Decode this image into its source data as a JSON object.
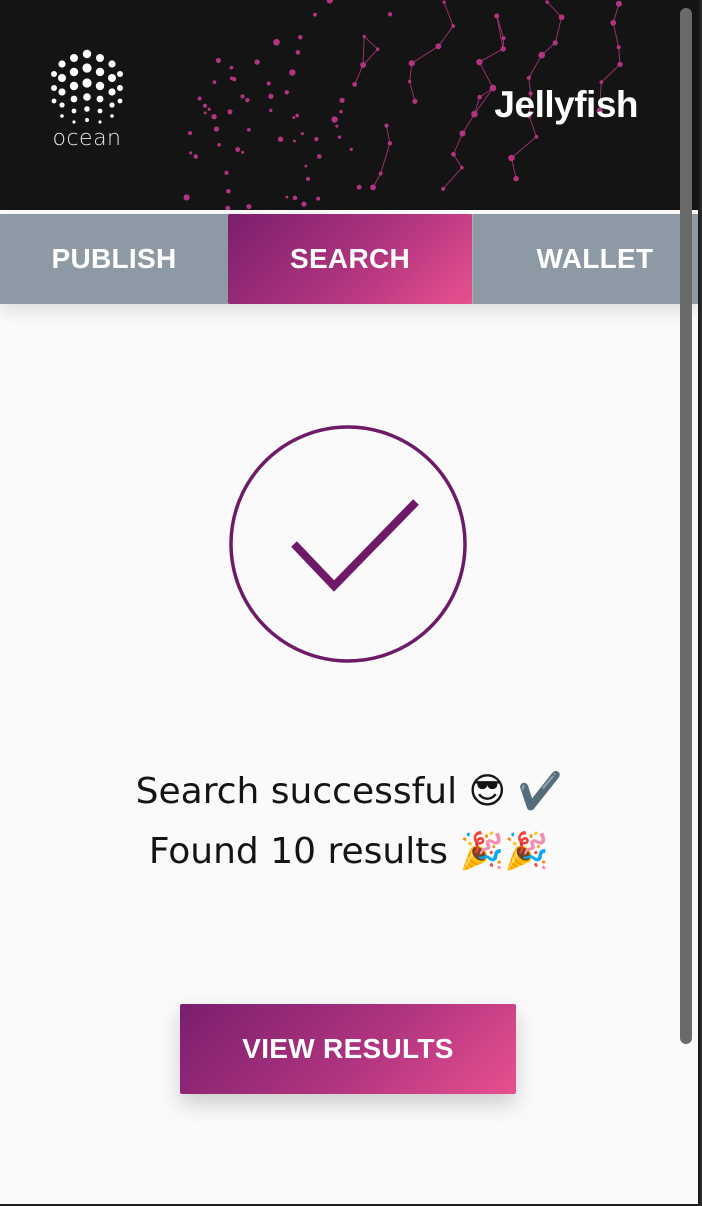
{
  "header": {
    "logo_text": "ocean",
    "brand": "Jellyfish",
    "accent_color": "#b0347f"
  },
  "tabs": [
    {
      "label": "PUBLISH",
      "active": false
    },
    {
      "label": "SEARCH",
      "active": true
    },
    {
      "label": "WALLET",
      "active": false
    }
  ],
  "status": {
    "icon": "checkmark-circle-icon",
    "line1": "Search successful",
    "line1_emoji": "😎 ✔️",
    "line2": "Found 10 results",
    "line2_emoji": "🎉🎉"
  },
  "actions": {
    "view_results_label": "VIEW RESULTS"
  }
}
